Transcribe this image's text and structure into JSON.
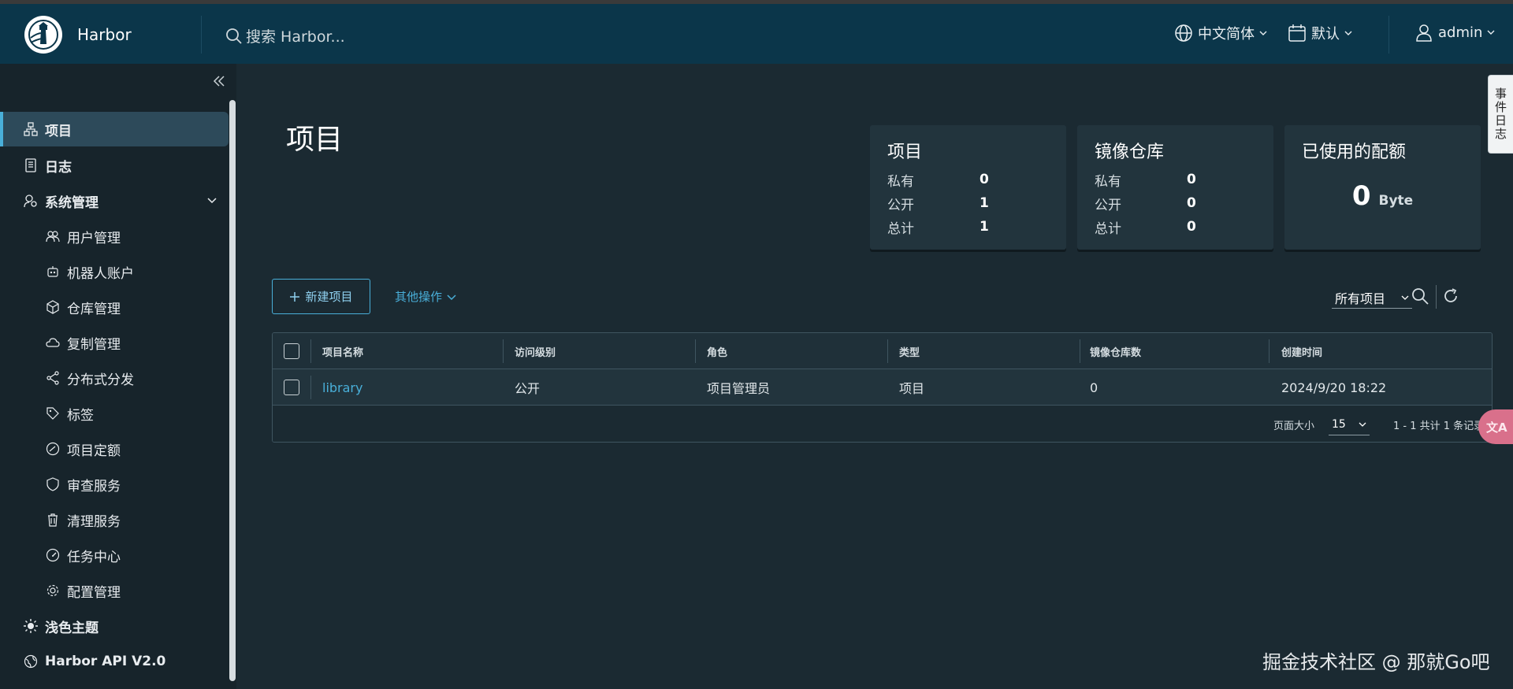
{
  "app": {
    "brand": "Harbor"
  },
  "header": {
    "search_placeholder": "搜索 Harbor...",
    "language": "中文简体",
    "datetime_format": "默认",
    "user": "admin"
  },
  "sidebar": {
    "items": [
      {
        "label": "项目",
        "icon": "projects-icon",
        "level": 0,
        "active": true
      },
      {
        "label": "日志",
        "icon": "logs-icon",
        "level": 0
      },
      {
        "label": "系统管理",
        "icon": "admin-icon",
        "level": 0,
        "expanded": true
      },
      {
        "label": "用户管理",
        "icon": "users-icon",
        "level": 1
      },
      {
        "label": "机器人账户",
        "icon": "robot-icon",
        "level": 1
      },
      {
        "label": "仓库管理",
        "icon": "registry-icon",
        "level": 1
      },
      {
        "label": "复制管理",
        "icon": "replication-icon",
        "level": 1
      },
      {
        "label": "分布式分发",
        "icon": "share-icon",
        "level": 1
      },
      {
        "label": "标签",
        "icon": "tag-icon",
        "level": 1
      },
      {
        "label": "项目定额",
        "icon": "quota-icon",
        "level": 1
      },
      {
        "label": "审查服务",
        "icon": "shield-icon",
        "level": 1
      },
      {
        "label": "清理服务",
        "icon": "trash-icon",
        "level": 1
      },
      {
        "label": "任务中心",
        "icon": "dashboard-icon",
        "level": 1
      },
      {
        "label": "配置管理",
        "icon": "gear-icon",
        "level": 1
      },
      {
        "label": "浅色主题",
        "icon": "sun-icon",
        "level": 0
      },
      {
        "label": "Harbor API V2.0",
        "icon": "globe-icon",
        "level": 0
      }
    ]
  },
  "main": {
    "title": "项目",
    "cards": {
      "projects": {
        "title": "项目",
        "rows": [
          {
            "k": "私有",
            "v": "0"
          },
          {
            "k": "公开",
            "v": "1"
          },
          {
            "k": "总计",
            "v": "1"
          }
        ]
      },
      "repos": {
        "title": "镜像仓库",
        "rows": [
          {
            "k": "私有",
            "v": "0"
          },
          {
            "k": "公开",
            "v": "0"
          },
          {
            "k": "总计",
            "v": "0"
          }
        ]
      },
      "quota": {
        "title": "已使用的配额",
        "value": "0",
        "unit": "Byte"
      }
    },
    "toolbar": {
      "new_project": "新建项目",
      "other_actions": "其他操作",
      "filter": "所有项目"
    },
    "table": {
      "columns": [
        "项目名称",
        "访问级别",
        "角色",
        "类型",
        "镜像仓库数",
        "创建时间"
      ],
      "rows": [
        [
          "library",
          "公开",
          "项目管理员",
          "项目",
          "0",
          "2024/9/20 18:22"
        ]
      ],
      "page_size_label": "页面大小",
      "page_size": "15",
      "records": "1 - 1 共计 1 条记录"
    }
  },
  "overlays": {
    "side_tab": "事件日志",
    "translate_bubble": "文A",
    "watermark": "掘金技术社区 @ 那就Go吧"
  },
  "colors": {
    "header": "#0b364a",
    "sidebar": "#17242b",
    "content": "#1b2a32",
    "accent": "#49afd9"
  }
}
